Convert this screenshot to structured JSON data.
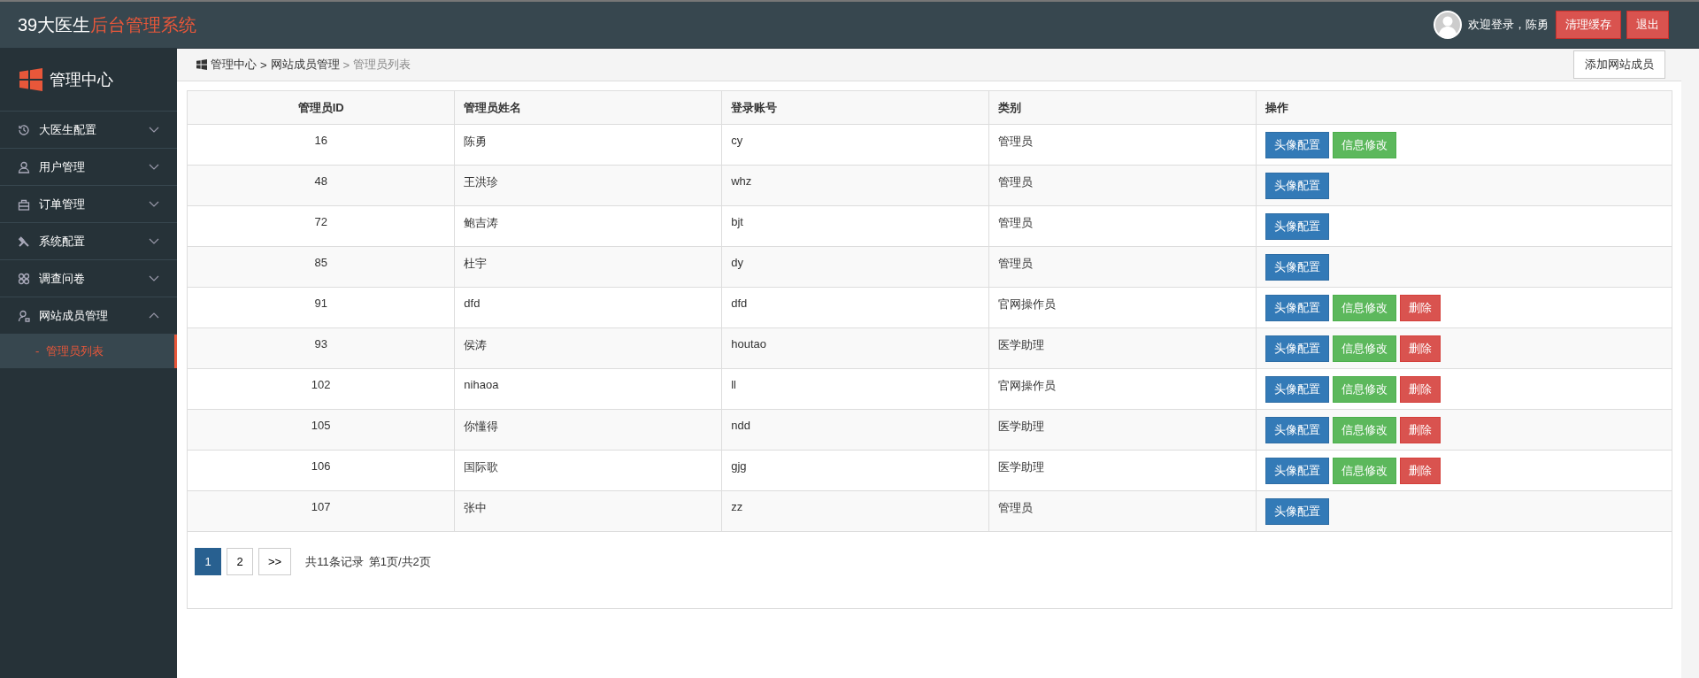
{
  "header": {
    "brand": "39大医生",
    "brand_highlight": "后台管理系统",
    "welcome": "欢迎登录，陈勇",
    "buttons": [
      {
        "label": "清理缓存"
      },
      {
        "label": "退出"
      }
    ]
  },
  "sidebar": {
    "title": "管理中心",
    "items": [
      {
        "label": "大医生配置",
        "expanded": false
      },
      {
        "label": "用户管理",
        "expanded": false
      },
      {
        "label": "订单管理",
        "expanded": false
      },
      {
        "label": "系统配置",
        "expanded": false
      },
      {
        "label": "调查问卷",
        "expanded": false
      },
      {
        "label": "网站成员管理",
        "expanded": true,
        "children": [
          {
            "marker": "-",
            "label": "管理员列表",
            "selected": true
          }
        ]
      }
    ]
  },
  "breadcrumb": [
    {
      "label": "管理中心",
      "current": false
    },
    {
      "separator": ">",
      "label": "网站成员管理",
      "current": false
    },
    {
      "separator": ">",
      "label": "管理员列表",
      "current": true
    }
  ],
  "add_button": "添加网站成员",
  "table": {
    "columns": [
      "管理员ID",
      "管理员姓名",
      "登录账号",
      "类别",
      "操作"
    ],
    "rows": [
      {
        "id": "16",
        "name": "陈勇",
        "account": "cy",
        "type": "管理员",
        "actions": [
          {
            "kind": "avatar",
            "label": "头像配置"
          },
          {
            "kind": "edit",
            "label": "信息修改"
          }
        ]
      },
      {
        "id": "48",
        "name": "王洪珍",
        "account": "whz",
        "type": "管理员",
        "actions": [
          {
            "kind": "avatar",
            "label": "头像配置"
          }
        ]
      },
      {
        "id": "72",
        "name": "鲍吉涛",
        "account": "bjt",
        "type": "管理员",
        "actions": [
          {
            "kind": "avatar",
            "label": "头像配置"
          }
        ]
      },
      {
        "id": "85",
        "name": "杜宇",
        "account": "dy",
        "type": "管理员",
        "actions": [
          {
            "kind": "avatar",
            "label": "头像配置"
          }
        ]
      },
      {
        "id": "91",
        "name": "dfd",
        "account": "dfd",
        "type": "官网操作员",
        "actions": [
          {
            "kind": "avatar",
            "label": "头像配置"
          },
          {
            "kind": "edit",
            "label": "信息修改"
          },
          {
            "kind": "delete",
            "label": "删除"
          }
        ]
      },
      {
        "id": "93",
        "name": "侯涛",
        "account": "houtao",
        "type": "医学助理",
        "actions": [
          {
            "kind": "avatar",
            "label": "头像配置"
          },
          {
            "kind": "edit",
            "label": "信息修改"
          },
          {
            "kind": "delete",
            "label": "删除"
          }
        ]
      },
      {
        "id": "102",
        "name": "nihaoa",
        "account": "ll",
        "type": "官网操作员",
        "actions": [
          {
            "kind": "avatar",
            "label": "头像配置"
          },
          {
            "kind": "edit",
            "label": "信息修改"
          },
          {
            "kind": "delete",
            "label": "删除"
          }
        ]
      },
      {
        "id": "105",
        "name": "你懂得",
        "account": "ndd",
        "type": "医学助理",
        "actions": [
          {
            "kind": "avatar",
            "label": "头像配置"
          },
          {
            "kind": "edit",
            "label": "信息修改"
          },
          {
            "kind": "delete",
            "label": "删除"
          }
        ]
      },
      {
        "id": "106",
        "name": "国际歌",
        "account": "gjg",
        "type": "医学助理",
        "actions": [
          {
            "kind": "avatar",
            "label": "头像配置"
          },
          {
            "kind": "edit",
            "label": "信息修改"
          },
          {
            "kind": "delete",
            "label": "删除"
          }
        ]
      },
      {
        "id": "107",
        "name": "张中",
        "account": "zz",
        "type": "管理员",
        "actions": [
          {
            "kind": "avatar",
            "label": "头像配置"
          }
        ]
      }
    ]
  },
  "pagination": {
    "pages": [
      {
        "label": "1",
        "selected": true
      },
      {
        "label": "2",
        "selected": false
      },
      {
        "label": ">>",
        "selected": false
      }
    ],
    "total": "共11条记录",
    "page_info": "第1页/共2页"
  }
}
